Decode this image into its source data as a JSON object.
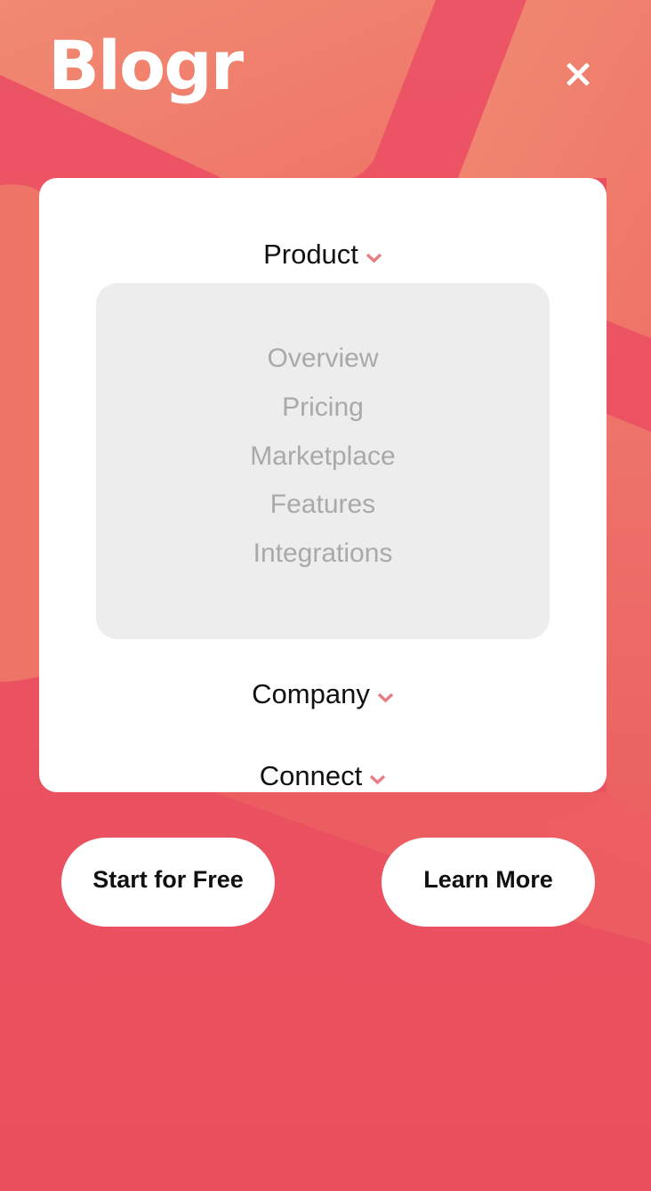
{
  "header": {
    "logo_text": "Blogr",
    "close_icon": "close-icon"
  },
  "menu": {
    "sections": [
      {
        "label": "Product",
        "icon": "chevron-down-icon",
        "expanded": true,
        "items": [
          "Overview",
          "Pricing",
          "Marketplace",
          "Features",
          "Integrations"
        ]
      },
      {
        "label": "Company",
        "icon": "chevron-down-icon",
        "expanded": false
      },
      {
        "label": "Connect",
        "icon": "chevron-down-icon",
        "expanded": false
      }
    ]
  },
  "cta": {
    "primary_label": "Start for Free",
    "secondary_label": "Learn More"
  },
  "colors": {
    "background": "#ea4f5d",
    "accent_light": "#f07e6d",
    "chevron": "#e87e85",
    "submenu_bg": "#ededed",
    "submenu_text": "#a9a9a9"
  }
}
